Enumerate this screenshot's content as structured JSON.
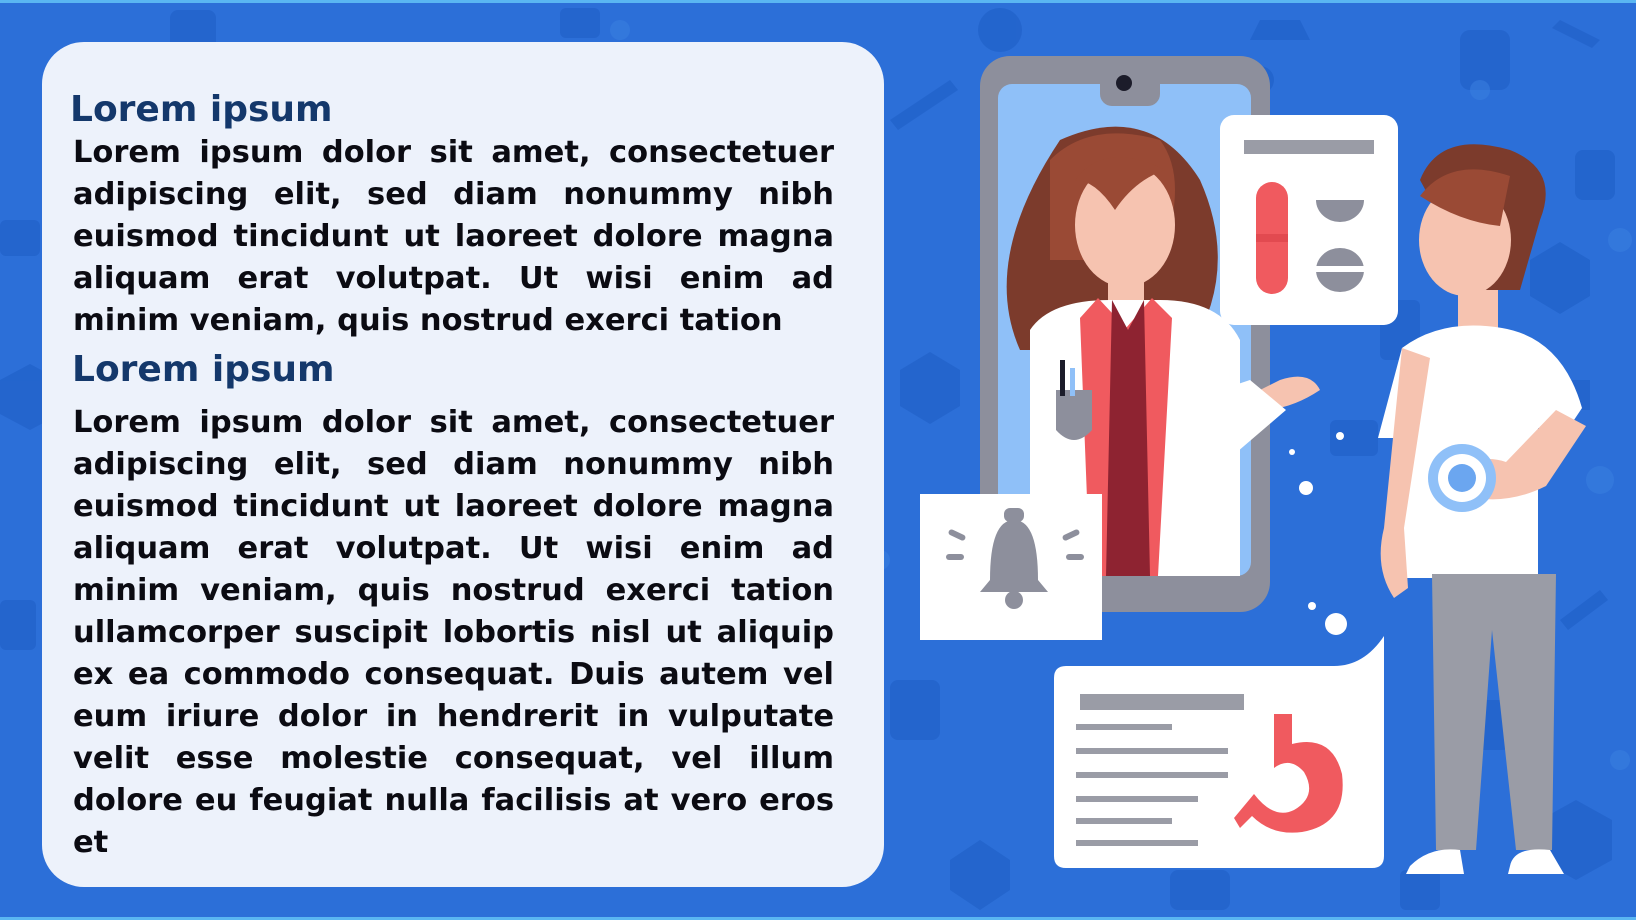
{
  "slide": {
    "sections": [
      {
        "heading": "Lorem ipsum",
        "body": "Lorem ipsum dolor sit amet, consectetuer adipiscing elit, sed diam nonummy nibh euismod tincidunt ut laoreet dolore magna aliquam erat volutpat. Ut wisi enim ad minim veniam, quis nostrud exerci tation"
      },
      {
        "heading": "Lorem ipsum",
        "body": "Lorem ipsum dolor sit amet, consectetuer adipiscing elit, sed diam nonummy nibh euismod tincidunt ut laoreet dolore magna aliquam erat volutpat. Ut wisi enim ad minim veniam, quis nostrud exerci tation ullamcorper suscipit lobortis nisl ut aliquip ex ea commodo consequat. Duis autem vel eum iriure dolor in hendrerit in vulputate velit esse molestie consequat, vel illum dolore eu feugiat nulla facilisis at vero eros et"
      }
    ]
  },
  "colors": {
    "background": "#2c6fd8",
    "panel": "#edf2fb",
    "heading": "#14386b",
    "accent_red": "#f05a5f",
    "phone_screen": "#8fc0f8",
    "phone_frame": "#8d8f9c"
  },
  "icons": [
    "bell-icon",
    "pill-icon",
    "stomach-icon",
    "medical-cross-icon",
    "syringe-icon",
    "heart-icon"
  ]
}
